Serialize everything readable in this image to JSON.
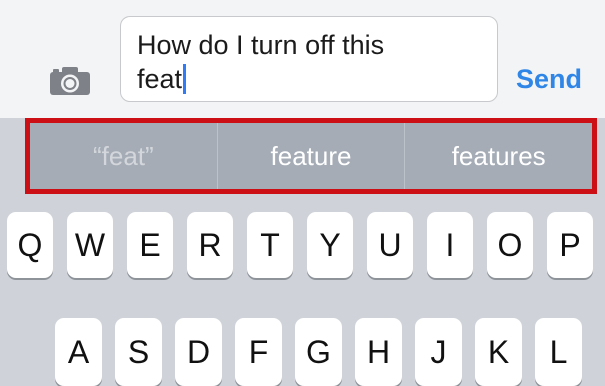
{
  "compose": {
    "message_line1": "How do I turn off this",
    "message_line2": "feat",
    "send_label": "Send",
    "camera_icon": "camera-icon"
  },
  "suggestions": [
    "“feat”",
    "feature",
    "features"
  ],
  "keyboard": {
    "row1": [
      "Q",
      "W",
      "E",
      "R",
      "T",
      "Y",
      "U",
      "I",
      "O",
      "P"
    ],
    "row2": [
      "A",
      "S",
      "D",
      "F",
      "G",
      "H",
      "J",
      "K",
      "L"
    ]
  },
  "colors": {
    "accent": "#2f86e6",
    "highlight": "#cc0f14",
    "suggestion_bar": "#a5acb6",
    "keyboard_bg": "#cfd3d9"
  }
}
